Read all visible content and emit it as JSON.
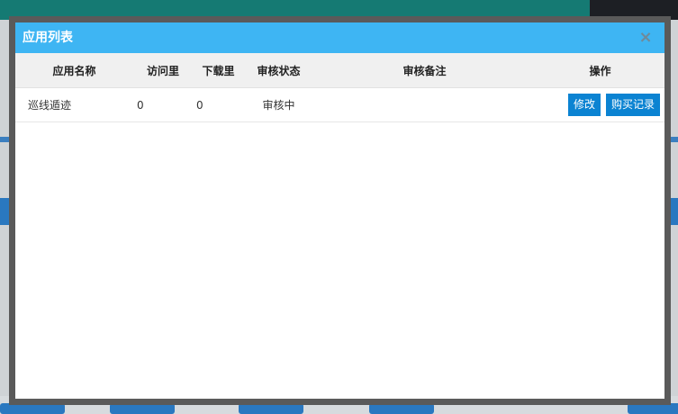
{
  "dialog": {
    "title": "应用列表",
    "close_symbol": "×"
  },
  "table": {
    "headers": [
      "应用名称",
      "访问里",
      "下载里",
      "审核状态",
      "审核备注",
      "操作"
    ],
    "rows": [
      {
        "name": "巡线遁迹",
        "visits": "0",
        "downloads": "0",
        "status": "审核中",
        "remark": "",
        "actions": [
          "修改",
          "购买记录"
        ]
      }
    ]
  },
  "colors": {
    "header_bg": "#3eb5f3",
    "button_bg": "#0b83d2",
    "overlay_border": "#5a5a5a"
  }
}
